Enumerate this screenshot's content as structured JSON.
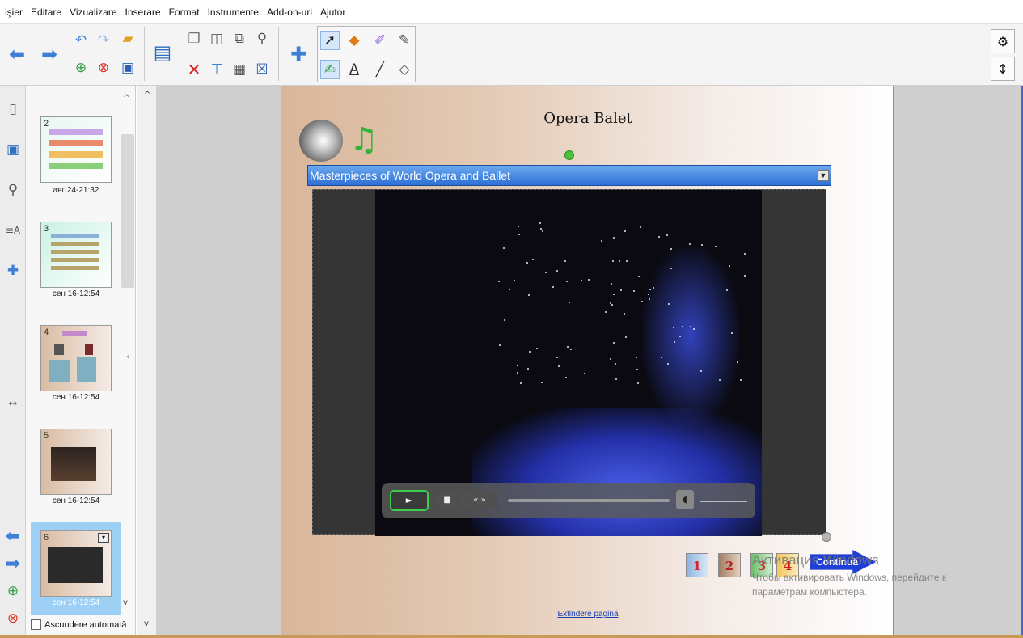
{
  "menu": [
    "işier",
    "Editare",
    "Vizualizare",
    "Inserare",
    "Format",
    "Instrumente",
    "Add-on-uri",
    "Ajutor"
  ],
  "toolbar": {
    "icons": [
      "back-arrow",
      "forward-arrow",
      "undo",
      "redo",
      "open-folder",
      "add-page",
      "delete-page",
      "save",
      "screen-display",
      "copy",
      "screenshot",
      "capture",
      "link",
      "delete",
      "screen-shade",
      "table",
      "clear",
      "add-on",
      "select",
      "fill",
      "magic-pen",
      "pen",
      "creative-pen",
      "text",
      "line",
      "eraser",
      "settings",
      "move-toolbar"
    ]
  },
  "sorter": {
    "pages": [
      {
        "num": "2",
        "caption": "авг 24-21:32"
      },
      {
        "num": "3",
        "caption": "сен 16-12:54"
      },
      {
        "num": "4",
        "caption": "сен 16-12:54"
      },
      {
        "num": "5",
        "caption": "сен 16-12:54"
      },
      {
        "num": "6",
        "caption": "сен 16-12:54"
      }
    ],
    "autohide_label": "Ascundere automată"
  },
  "page": {
    "title": "Opera Balet",
    "select_value": "Masterpieces of World Opera and Ballet",
    "nav_numbers": [
      "1",
      "2",
      "3",
      "4"
    ],
    "nav_colors": [
      "#d8262a",
      "#b5211c",
      "#d42020",
      "#c81f1f"
    ],
    "continue_label": "Continuă",
    "extend_link": "Extindere pagină"
  },
  "activation": {
    "line1": "Активация Windows",
    "line2": "Чтобы активировать Windows, перейдите к",
    "line3": "параметрам компьютера."
  }
}
